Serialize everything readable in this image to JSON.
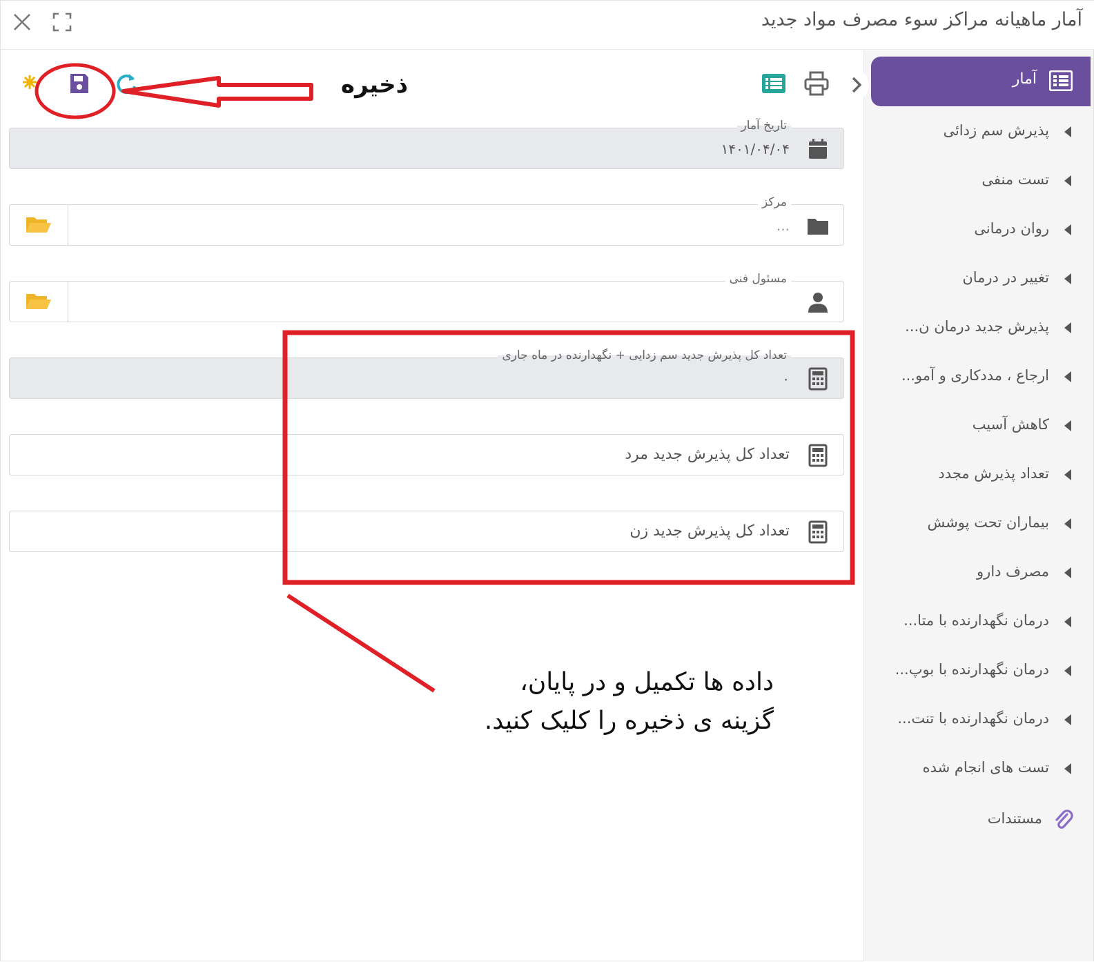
{
  "window": {
    "title": "آمار ماهیانه مراکز سوء مصرف مواد جدید",
    "close_icon": "close-icon",
    "fullscreen_icon": "fullscreen-icon"
  },
  "sidebar": {
    "header": {
      "label": "آمار",
      "icon": "list-icon"
    },
    "items": [
      {
        "label": "پذیرش سم زدائی"
      },
      {
        "label": "تست منفی"
      },
      {
        "label": "روان درمانی"
      },
      {
        "label": "تغییر در درمان"
      },
      {
        "label": "پذیرش جدید درمان ن..."
      },
      {
        "label": "ارجاع ، مددکاری و آمو..."
      },
      {
        "label": "کاهش آسیب"
      },
      {
        "label": "تعداد پذیرش مجدد"
      },
      {
        "label": "بیماران تحت پوشش"
      },
      {
        "label": "مصرف دارو"
      },
      {
        "label": "درمان نگهدارنده با متا..."
      },
      {
        "label": "درمان نگهدارنده با بوپ..."
      },
      {
        "label": "درمان نگهدارنده با تنت..."
      },
      {
        "label": "تست های انجام شده"
      }
    ],
    "documents": {
      "label": "مستندات",
      "icon": "paperclip-icon"
    }
  },
  "toolbar": {
    "save_label": "ذخیره",
    "icons": [
      "new-icon",
      "save-icon",
      "refresh-icon",
      "print-icon",
      "list-view-icon"
    ]
  },
  "form": {
    "date": {
      "legend": "تاریخ آمار",
      "value": "۱۴۰۱/۰۴/۰۴"
    },
    "center": {
      "legend": "مرکز",
      "value": "..."
    },
    "technical_manager": {
      "legend": "مسئول فنی",
      "value": ""
    },
    "total_new": {
      "legend": "تعداد کل پذیرش جدید سم زدایی + نگهدارنده در ماه جاری",
      "value": "۰"
    },
    "total_new_male": {
      "label": "تعداد کل پذیرش جدید مرد"
    },
    "total_new_female": {
      "label": "تعداد کل پذیرش جدید زن"
    }
  },
  "annotation": {
    "line1": "داده ها تکمیل و در پایان،",
    "line2": "گزینه ی ذخیره را کلیک کنید."
  },
  "colors": {
    "accent": "#6a4f9e",
    "annotation_red": "#e02027",
    "folder_yellow": "#f0b429",
    "teal": "#26a69a"
  }
}
